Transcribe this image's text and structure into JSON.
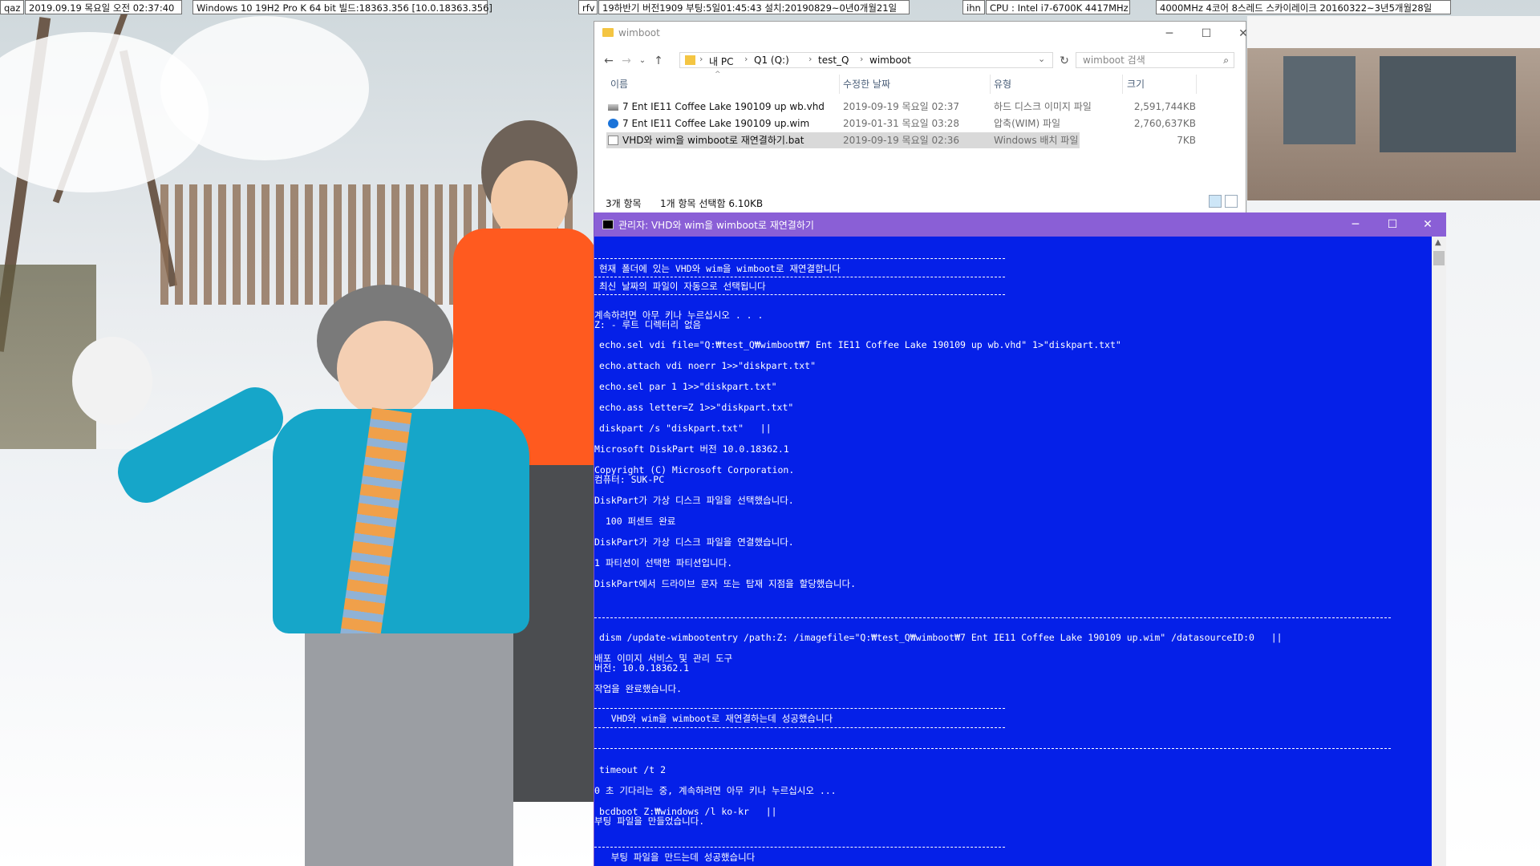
{
  "topbar": [
    {
      "text": "qaz"
    },
    {
      "text": "2019.09.19 목요일 오전 02:37:40"
    },
    {
      "text": "Windows 10 19H2 Pro K 64 bit 빌드:18363.356 [10.0.18363.356]"
    },
    {
      "text": "rfv"
    },
    {
      "text": "19하반기 버전1909 부팅:5일01:45:43 설치:20190829~0년0개월21일"
    },
    {
      "text": "ihn"
    },
    {
      "text": "CPU : Intel i7-6700K 4417MHz"
    },
    {
      "text": "4000MHz 4코어 8스레드 스카이레이크 20160322~3년5개월28일"
    }
  ],
  "explorer": {
    "title": "wimboot",
    "minimize": "─",
    "maximize": "☐",
    "close": "✕",
    "nav": {
      "back": "←",
      "forward": "→",
      "recent": "⌄",
      "up": "↑"
    },
    "breadcrumb": [
      "내 PC",
      "Q1 (Q:)",
      "test_Q",
      "wimboot"
    ],
    "addr_dropdown": "⌄",
    "refresh": "↻",
    "search_placeholder": "wimboot 검색",
    "search_icon": "⌕",
    "columns": {
      "name": "이름",
      "date": "수정한 날짜",
      "type": "유형",
      "size": "크기"
    },
    "sort_arrow": "^",
    "files": [
      {
        "name": "7 Ent IE11 Coffee Lake 190109 up wb.vhd",
        "date": "2019-09-19 목요일 02:37",
        "type": "하드 디스크 이미지 파일",
        "size": "2,591,744KB",
        "icon": "vhd-file-icon"
      },
      {
        "name": "7 Ent IE11 Coffee Lake 190109 up.wim",
        "date": "2019-01-31 목요일 03:28",
        "type": "압축(WIM) 파일",
        "size": "2,760,637KB",
        "icon": "wim-file-icon"
      },
      {
        "name": "VHD와 wim을 wimboot로 재연결하기.bat",
        "date": "2019-09-19 목요일 02:36",
        "type": "Windows 배치 파일",
        "size": "7KB",
        "icon": "bat-file-icon"
      }
    ],
    "status_count": "3개 항목",
    "status_selected": "1개 항목 선택함 6.10KB"
  },
  "cmd": {
    "title": "관리자:  VHD와 wim을 wimboot로 재연결하기",
    "minimize": "─",
    "maximize": "☐",
    "close": "✕",
    "scroll_up": "▲",
    "lines": [
      "현재 폴더에 있는 VHD와 wim을 wimboot로 재연결합니다",
      "최신 날짜의 파일이 자동으로 선택됩니다",
      "계속하려면 아무 키나 누르십시오 . . .",
      "Z: - 루트 디렉터리 없음",
      "echo.sel vdi file=\"Q:₩test_Q₩wimboot₩7 Ent IE11 Coffee Lake 190109 up wb.vhd\" 1>\"diskpart.txt\"",
      "echo.attach vdi noerr 1>>\"diskpart.txt\"",
      "echo.sel par 1 1>>\"diskpart.txt\"",
      "echo.ass letter=Z 1>>\"diskpart.txt\"",
      "diskpart /s \"diskpart.txt\"   ||",
      "Microsoft DiskPart 버전 10.0.18362.1",
      "Copyright (C) Microsoft Corporation.",
      "컴퓨터: SUK-PC",
      "DiskPart가 가상 디스크 파일을 선택했습니다.",
      "  100 퍼센트 완료",
      "DiskPart가 가상 디스크 파일을 연결했습니다.",
      "1 파티션이 선택한 파티션입니다.",
      "DiskPart에서 드라이브 문자 또는 탑재 지점을 할당했습니다.",
      "dism /update-wimbootentry /path:Z: /imagefile=\"Q:₩test_Q₩wimboot₩7 Ent IE11 Coffee Lake 190109 up.wim\" /datasourceID:0   ||",
      "배포 이미지 서비스 및 관리 도구",
      "버전: 10.0.18362.1",
      "작업을 완료했습니다.",
      "   VHD와 wim을 wimboot로 재연결하는데 성공했습니다",
      "timeout /t 2",
      "0 초 기다리는 중, 계속하려면 아무 키나 누르십시오 ...",
      "bcdboot Z:₩windows /l ko-kr   ||",
      "부팅 파일을 만들었습니다.",
      "   부팅 파일을 만드는데 성공했습니다"
    ]
  }
}
